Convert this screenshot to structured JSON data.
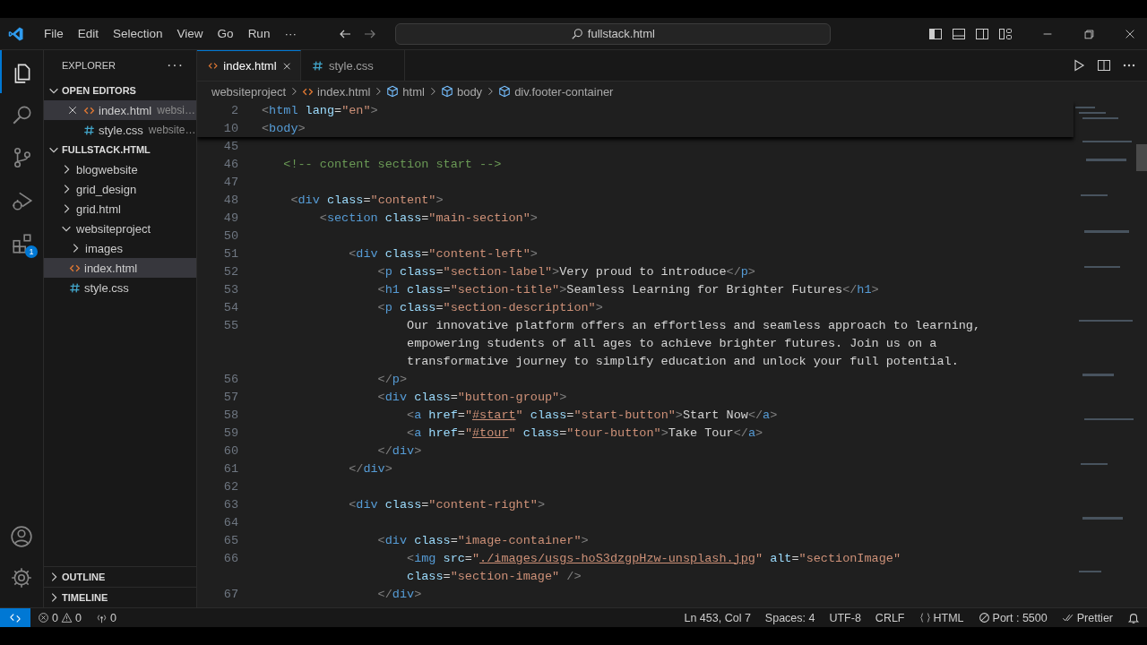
{
  "title_bar": {
    "menu": [
      "File",
      "Edit",
      "Selection",
      "View",
      "Go",
      "Run",
      "···"
    ],
    "search": "fullstack.html"
  },
  "activity_bar": [
    {
      "kind": "explorer",
      "selected": true
    },
    {
      "kind": "search",
      "selected": false
    },
    {
      "kind": "scm",
      "selected": false
    },
    {
      "kind": "debug",
      "selected": false
    },
    {
      "kind": "extensions",
      "selected": false,
      "badge": "1"
    }
  ],
  "sidebar": {
    "title": "EXPLORER",
    "more": "···",
    "open_editors": {
      "title": "OPEN EDITORS",
      "expanded": true,
      "items": [
        {
          "name": "index.html",
          "path": "websi…",
          "kind": "html",
          "selected": true
        },
        {
          "name": "style.css",
          "path": "website…",
          "kind": "css",
          "selected": false
        }
      ]
    },
    "folder": {
      "title": "FULLSTACK.HTML",
      "expanded": true,
      "children": [
        {
          "name": "blogwebsite",
          "kind": "folder",
          "expanded": false,
          "selected": false
        },
        {
          "name": "grid_design",
          "kind": "folder",
          "expanded": false,
          "selected": false
        },
        {
          "name": "grid.html",
          "kind": "folder",
          "expanded": false,
          "selected": false
        },
        {
          "name": "websiteproject",
          "kind": "folder",
          "expanded": true,
          "selected": false,
          "children": [
            {
              "name": "images",
              "kind": "folder",
              "expanded": false,
              "selected": false
            },
            {
              "name": "index.html",
              "kind": "html",
              "selected": true
            },
            {
              "name": "style.css",
              "kind": "css",
              "selected": false
            }
          ]
        }
      ]
    },
    "panels": [
      {
        "title": "OUTLINE",
        "expanded": false
      },
      {
        "title": "TIMELINE",
        "expanded": false
      }
    ]
  },
  "tabs": [
    {
      "label": "index.html",
      "kind": "html",
      "selected": true
    },
    {
      "label": "style.css",
      "kind": "css",
      "selected": false
    }
  ],
  "breadcrumb": [
    {
      "label": "websiteproject",
      "kind": "folder"
    },
    {
      "label": "index.html",
      "kind": "html"
    },
    {
      "label": "html",
      "kind": "element"
    },
    {
      "label": "body",
      "kind": "element"
    },
    {
      "label": "div.footer-container",
      "kind": "element"
    }
  ],
  "editor": {
    "sticky": [
      {
        "num": "2",
        "t": [
          {
            "kind": "p",
            "text": "<"
          },
          {
            "kind": "tag",
            "text": "html"
          },
          {
            "kind": "attr",
            "text": " lang"
          },
          {
            "kind": "eq",
            "text": "="
          },
          {
            "kind": "str",
            "text": "\"en\""
          },
          {
            "kind": "p",
            "text": ">"
          }
        ]
      },
      {
        "num": "10",
        "t": [
          {
            "kind": "p",
            "text": "<"
          },
          {
            "kind": "tag",
            "text": "body"
          },
          {
            "kind": "p",
            "text": ">"
          }
        ]
      }
    ],
    "lines": [
      {
        "num": "45"
      },
      {
        "num": "46",
        "t": [
          {
            "kind": "cm",
            "text": "   <!-- content section start -->"
          }
        ]
      },
      {
        "num": "47"
      },
      {
        "num": "48",
        "t": [
          {
            "kind": "p",
            "text": "    <"
          },
          {
            "kind": "tag",
            "text": "div"
          },
          {
            "kind": "attr",
            "text": " class"
          },
          {
            "kind": "eq",
            "text": "="
          },
          {
            "kind": "str",
            "text": "\"content\""
          },
          {
            "kind": "p",
            "text": ">"
          }
        ]
      },
      {
        "num": "49",
        "t": [
          {
            "kind": "p",
            "text": "        <"
          },
          {
            "kind": "tag",
            "text": "section"
          },
          {
            "kind": "attr",
            "text": " class"
          },
          {
            "kind": "eq",
            "text": "="
          },
          {
            "kind": "str",
            "text": "\"main-section\""
          },
          {
            "kind": "p",
            "text": ">"
          }
        ]
      },
      {
        "num": "50"
      },
      {
        "num": "51",
        "t": [
          {
            "kind": "p",
            "text": "            <"
          },
          {
            "kind": "tag",
            "text": "div"
          },
          {
            "kind": "attr",
            "text": " class"
          },
          {
            "kind": "eq",
            "text": "="
          },
          {
            "kind": "str",
            "text": "\"content-left\""
          },
          {
            "kind": "p",
            "text": ">"
          }
        ]
      },
      {
        "num": "52",
        "t": [
          {
            "kind": "p",
            "text": "                <"
          },
          {
            "kind": "tag",
            "text": "p"
          },
          {
            "kind": "attr",
            "text": " class"
          },
          {
            "kind": "eq",
            "text": "="
          },
          {
            "kind": "str",
            "text": "\"section-label\""
          },
          {
            "kind": "p",
            "text": ">"
          },
          {
            "kind": "txt",
            "text": "Very proud to introduce"
          },
          {
            "kind": "p",
            "text": "</"
          },
          {
            "kind": "tag",
            "text": "p"
          },
          {
            "kind": "p",
            "text": ">"
          }
        ]
      },
      {
        "num": "53",
        "t": [
          {
            "kind": "p",
            "text": "                <"
          },
          {
            "kind": "tag",
            "text": "h1"
          },
          {
            "kind": "attr",
            "text": " class"
          },
          {
            "kind": "eq",
            "text": "="
          },
          {
            "kind": "str",
            "text": "\"section-title\""
          },
          {
            "kind": "p",
            "text": ">"
          },
          {
            "kind": "txt",
            "text": "Seamless Learning for Brighter Futures"
          },
          {
            "kind": "p",
            "text": "</"
          },
          {
            "kind": "tag",
            "text": "h1"
          },
          {
            "kind": "p",
            "text": ">"
          }
        ]
      },
      {
        "num": "54",
        "t": [
          {
            "kind": "p",
            "text": "                <"
          },
          {
            "kind": "tag",
            "text": "p"
          },
          {
            "kind": "attr",
            "text": " class"
          },
          {
            "kind": "eq",
            "text": "="
          },
          {
            "kind": "str",
            "text": "\"section-description\""
          },
          {
            "kind": "p",
            "text": ">"
          }
        ]
      },
      {
        "num": "55",
        "t": [
          {
            "kind": "txt",
            "text": "                    Our innovative platform offers an effortless and seamless approach to learning,"
          }
        ]
      },
      {
        "t": [
          {
            "kind": "txt",
            "text": "                    empowering students of all ages to achieve brighter futures. Join us on a"
          }
        ]
      },
      {
        "t": [
          {
            "kind": "txt",
            "text": "                    transformative journey to simplify education and unlock your full potential."
          }
        ]
      },
      {
        "num": "56",
        "t": [
          {
            "kind": "p",
            "text": "                </"
          },
          {
            "kind": "tag",
            "text": "p"
          },
          {
            "kind": "p",
            "text": ">"
          }
        ]
      },
      {
        "num": "57",
        "t": [
          {
            "kind": "p",
            "text": "                <"
          },
          {
            "kind": "tag",
            "text": "div"
          },
          {
            "kind": "attr",
            "text": " class"
          },
          {
            "kind": "eq",
            "text": "="
          },
          {
            "kind": "str",
            "text": "\"button-group\""
          },
          {
            "kind": "p",
            "text": ">"
          }
        ]
      },
      {
        "num": "58",
        "t": [
          {
            "kind": "p",
            "text": "                    <"
          },
          {
            "kind": "tag",
            "text": "a"
          },
          {
            "kind": "attr",
            "text": " href"
          },
          {
            "kind": "eq",
            "text": "="
          },
          {
            "kind": "str",
            "text": "\""
          },
          {
            "kind": "link",
            "text": "#start"
          },
          {
            "kind": "str",
            "text": "\""
          },
          {
            "kind": "attr",
            "text": " class"
          },
          {
            "kind": "eq",
            "text": "="
          },
          {
            "kind": "str",
            "text": "\"start-button\""
          },
          {
            "kind": "p",
            "text": ">"
          },
          {
            "kind": "txt",
            "text": "Start Now"
          },
          {
            "kind": "p",
            "text": "</"
          },
          {
            "kind": "tag",
            "text": "a"
          },
          {
            "kind": "p",
            "text": ">"
          }
        ]
      },
      {
        "num": "59",
        "t": [
          {
            "kind": "p",
            "text": "                    <"
          },
          {
            "kind": "tag",
            "text": "a"
          },
          {
            "kind": "attr",
            "text": " href"
          },
          {
            "kind": "eq",
            "text": "="
          },
          {
            "kind": "str",
            "text": "\""
          },
          {
            "kind": "link",
            "text": "#tour"
          },
          {
            "kind": "str",
            "text": "\""
          },
          {
            "kind": "attr",
            "text": " class"
          },
          {
            "kind": "eq",
            "text": "="
          },
          {
            "kind": "str",
            "text": "\"tour-button\""
          },
          {
            "kind": "p",
            "text": ">"
          },
          {
            "kind": "txt",
            "text": "Take Tour"
          },
          {
            "kind": "p",
            "text": "</"
          },
          {
            "kind": "tag",
            "text": "a"
          },
          {
            "kind": "p",
            "text": ">"
          }
        ]
      },
      {
        "num": "60",
        "t": [
          {
            "kind": "p",
            "text": "                </"
          },
          {
            "kind": "tag",
            "text": "div"
          },
          {
            "kind": "p",
            "text": ">"
          }
        ]
      },
      {
        "num": "61",
        "t": [
          {
            "kind": "p",
            "text": "            </"
          },
          {
            "kind": "tag",
            "text": "div"
          },
          {
            "kind": "p",
            "text": ">"
          }
        ]
      },
      {
        "num": "62"
      },
      {
        "num": "63",
        "t": [
          {
            "kind": "p",
            "text": "            <"
          },
          {
            "kind": "tag",
            "text": "div"
          },
          {
            "kind": "attr",
            "text": " class"
          },
          {
            "kind": "eq",
            "text": "="
          },
          {
            "kind": "str",
            "text": "\"content-right\""
          },
          {
            "kind": "p",
            "text": ">"
          }
        ]
      },
      {
        "num": "64"
      },
      {
        "num": "65",
        "t": [
          {
            "kind": "p",
            "text": "                <"
          },
          {
            "kind": "tag",
            "text": "div"
          },
          {
            "kind": "attr",
            "text": " class"
          },
          {
            "kind": "eq",
            "text": "="
          },
          {
            "kind": "str",
            "text": "\"image-container\""
          },
          {
            "kind": "p",
            "text": ">"
          }
        ]
      },
      {
        "num": "66",
        "t": [
          {
            "kind": "p",
            "text": "                    <"
          },
          {
            "kind": "tag",
            "text": "img"
          },
          {
            "kind": "attr",
            "text": " src"
          },
          {
            "kind": "eq",
            "text": "="
          },
          {
            "kind": "str",
            "text": "\""
          },
          {
            "kind": "link",
            "text": "./images/usgs-hoS3dzgpHzw-unsplash.jpg"
          },
          {
            "kind": "str",
            "text": "\""
          },
          {
            "kind": "attr",
            "text": " alt"
          },
          {
            "kind": "eq",
            "text": "="
          },
          {
            "kind": "str",
            "text": "\"sectionImage\""
          }
        ]
      },
      {
        "t": [
          {
            "kind": "attr",
            "text": "                    class"
          },
          {
            "kind": "eq",
            "text": "="
          },
          {
            "kind": "str",
            "text": "\"section-image\""
          },
          {
            "kind": "p",
            "text": " />"
          }
        ]
      },
      {
        "num": "67",
        "t": [
          {
            "kind": "p",
            "text": "                </"
          },
          {
            "kind": "tag",
            "text": "div"
          },
          {
            "kind": "p",
            "text": ">"
          }
        ]
      }
    ]
  },
  "status_bar": {
    "errors": "0",
    "warnings": "0",
    "ports": "0",
    "right": [
      {
        "kind": "text",
        "label": "Ln 453, Col 7"
      },
      {
        "kind": "text",
        "label": "Spaces: 4"
      },
      {
        "kind": "text",
        "label": "UTF-8"
      },
      {
        "kind": "text",
        "label": "CRLF"
      },
      {
        "kind": "language",
        "label": "HTML"
      },
      {
        "kind": "port",
        "label": "Port : 5500"
      },
      {
        "kind": "prettier",
        "label": "Prettier"
      },
      {
        "kind": "bell"
      }
    ]
  }
}
